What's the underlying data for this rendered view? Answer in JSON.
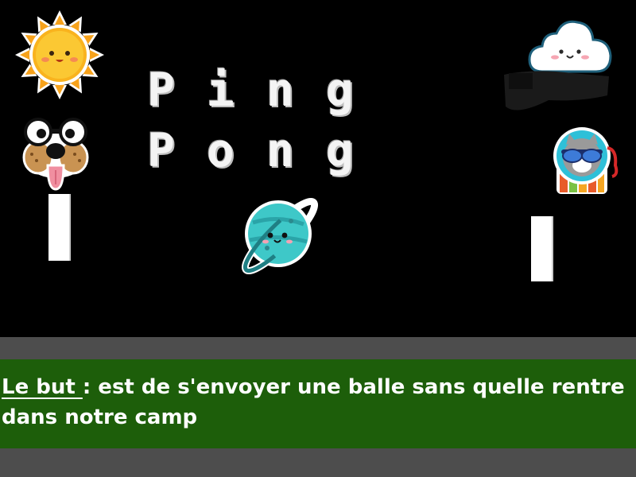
{
  "game": {
    "title_line1": "Ping",
    "title_line2": "Pong",
    "sprites": [
      "sun-sprite",
      "cloud-sprite",
      "dog-sprite",
      "cat-sprite",
      "planet-ball-sprite"
    ]
  },
  "instructions": {
    "label": "Le but ",
    "text": ": est de s'envoyer une balle sans quelle rentre dans notre camp"
  },
  "colors": {
    "background": "#000000",
    "panel": "#1d5e0a",
    "bar": "#4d4d4d",
    "text": "#ffffff"
  }
}
